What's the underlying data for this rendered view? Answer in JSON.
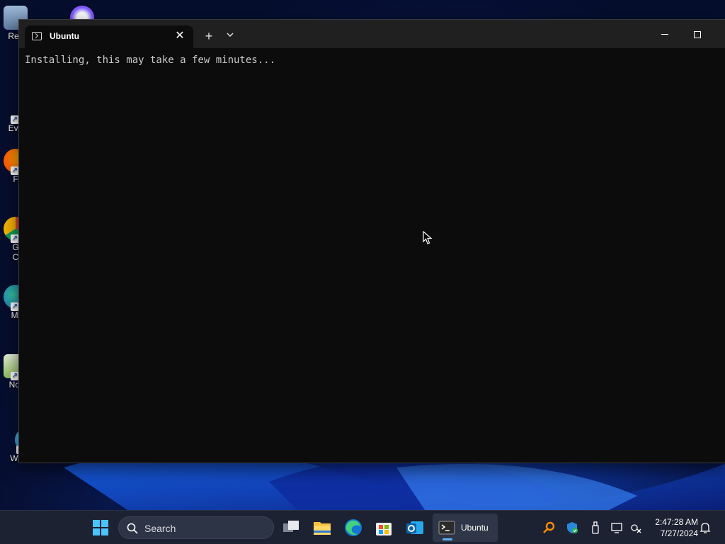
{
  "desktop": {
    "icons": [
      {
        "label": "Rec",
        "icon": "recycle-bin-icon"
      },
      {
        "label": "Eve",
        "icon": "event-shortcut-icon"
      },
      {
        "label": "F",
        "icon": "firefox-shortcut-icon"
      },
      {
        "label": "G\nC",
        "icon": "chrome-shortcut-icon"
      },
      {
        "label": "Mi",
        "icon": "edge-shortcut-icon"
      },
      {
        "label": "Not",
        "icon": "notepad-shortcut-icon"
      },
      {
        "label": "Waterfox",
        "icon": "waterfox-shortcut-icon"
      }
    ]
  },
  "window": {
    "tab_title": "Ubuntu",
    "tab_icon": "terminal-icon",
    "close_tab": "✕",
    "new_tab": "+",
    "dropdown": "⌄",
    "terminal_output": "Installing, this may take a few minutes..."
  },
  "taskbar": {
    "search_placeholder": "Search",
    "active_app_label": "Ubuntu",
    "time": "2:47:28 AM",
    "date": "7/27/2024",
    "colors": {
      "accent": "#5fb2f2",
      "taskbar_bg": "#1c2231",
      "terminal_bg": "#0c0c0c"
    }
  }
}
